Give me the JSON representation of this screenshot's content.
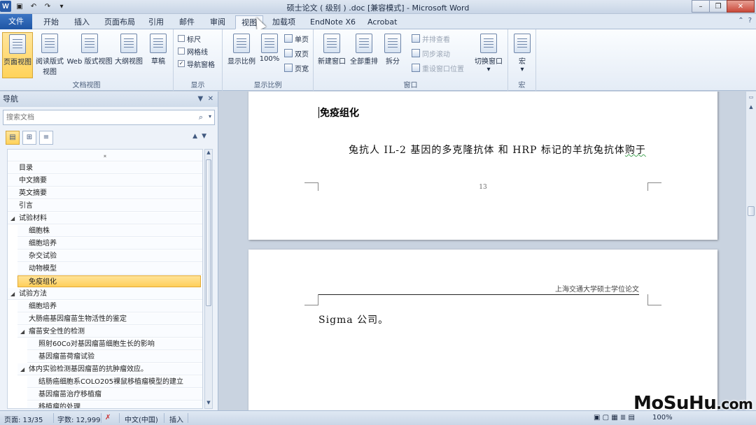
{
  "window": {
    "title": "硕士论文 ( 级别 ) .doc [兼容模式] - Microsoft Word",
    "app_icon": "W"
  },
  "tabs": {
    "file": "文件",
    "items": [
      "开始",
      "插入",
      "页面布局",
      "引用",
      "邮件",
      "审阅",
      "视图",
      "加载项",
      "EndNote X6",
      "Acrobat"
    ],
    "active": "视图"
  },
  "ribbon": {
    "doc_views": {
      "label": "文档视图",
      "page_view": "页面视图",
      "reading_line1": "阅读版式",
      "reading_line2": "视图",
      "web_view": "Web 版式视图",
      "outline_view": "大纲视图",
      "draft": "草稿"
    },
    "show": {
      "label": "显示",
      "ruler": "标尺",
      "gridlines": "网格线",
      "nav_pane": "导航窗格",
      "nav_pane_checked": "✓"
    },
    "zoom": {
      "label": "显示比例",
      "zoom": "显示比例",
      "hundred": "100%",
      "one_page": "单页",
      "two_pages": "双页",
      "page_width": "页宽"
    },
    "window_group": {
      "label": "窗口",
      "new_window": "新建窗口",
      "arrange_all": "全部重排",
      "split": "拆分",
      "side_by_side": "并排查看",
      "sync_scroll": "同步滚动",
      "reset_position": "重设窗口位置",
      "switch_windows": "切换窗口"
    },
    "macros": {
      "label": "宏",
      "macros": "宏"
    }
  },
  "nav": {
    "title": "导航",
    "search_placeholder": "搜索文档",
    "items": [
      {
        "label": "目录"
      },
      {
        "label": "中文摘要"
      },
      {
        "label": "英文摘要"
      },
      {
        "label": "引言"
      },
      {
        "label": "试验材料"
      },
      {
        "label": "细胞株"
      },
      {
        "label": "细胞培养"
      },
      {
        "label": "杂交试验"
      },
      {
        "label": "动物模型"
      },
      {
        "label": "免疫组化"
      },
      {
        "label": "试验方法"
      },
      {
        "label": "细胞培养"
      },
      {
        "label": "大肠癌基因瘤苗生物活性的鉴定"
      },
      {
        "label": "瘤苗安全性的检测"
      },
      {
        "label": "照射60Co对基因瘤苗细胞生长的影响"
      },
      {
        "label": "基因瘤苗荷瘤试验"
      },
      {
        "label": "体内实验检测基因瘤苗的抗肿瘤效应。"
      },
      {
        "label": "结肠癌细胞系COLO205裸鼠移植瘤模型的建立"
      },
      {
        "label": "基因瘤苗治疗移植瘤"
      },
      {
        "label": "移植瘤的处理"
      }
    ]
  },
  "document": {
    "page1": {
      "heading": "免疫组化",
      "body_a": "兔抗人 IL-2 基因的多克隆抗体 和 HRP 标记的羊抗兔抗体",
      "body_b": "购于",
      "page_number": "13"
    },
    "page2": {
      "header": "上海交通大学硕士学位论文",
      "body": "Sigma 公司。"
    }
  },
  "status": {
    "page": "页面: 13/35",
    "words": "字数: 12,999",
    "language": "中文(中国)",
    "mode": "插入",
    "zoom": "100%"
  },
  "watermark": {
    "main": "MoSuHu",
    "suffix": ".com"
  }
}
